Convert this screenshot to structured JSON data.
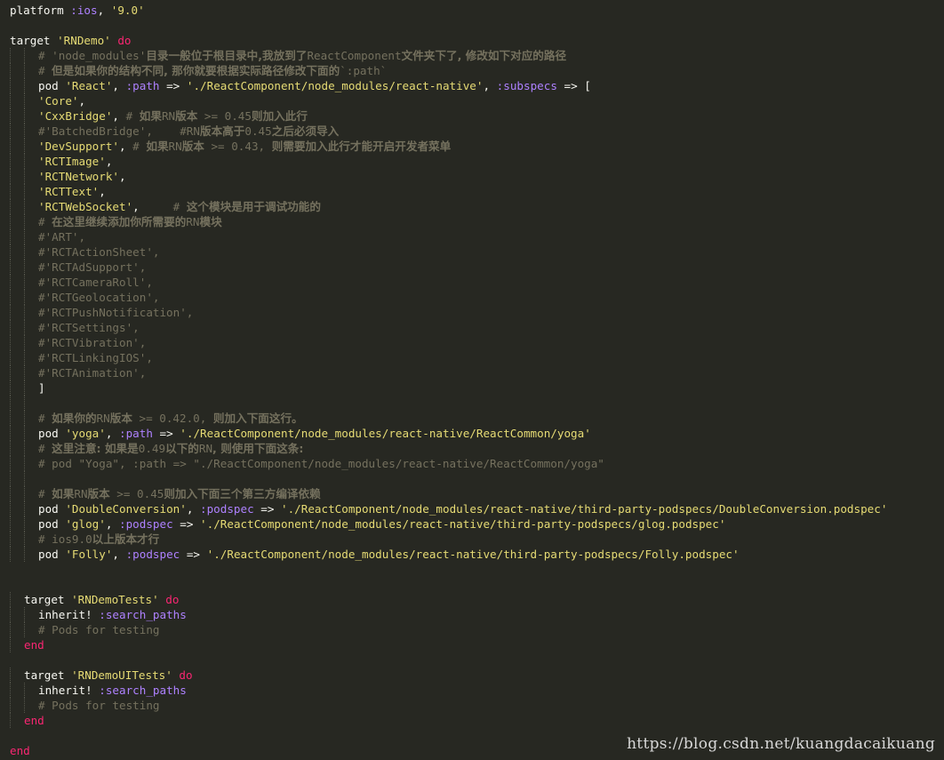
{
  "editor": {
    "theme": {
      "background": "#272822",
      "plain": "#f8f8f2",
      "string": "#e6db74",
      "symbol": "#ae81ff",
      "keyword": "#f92672",
      "comment": "#75715e"
    },
    "lines": [
      {
        "indent": 0,
        "tokens": [
          {
            "t": "platform ",
            "c": "plain"
          },
          {
            "t": ":ios",
            "c": "sym"
          },
          {
            "t": ", ",
            "c": "plain"
          },
          {
            "t": "'9.0'",
            "c": "str"
          }
        ]
      },
      {
        "indent": 0,
        "tokens": []
      },
      {
        "indent": 0,
        "tokens": [
          {
            "t": "target ",
            "c": "plain"
          },
          {
            "t": "'RNDemo'",
            "c": "str"
          },
          {
            "t": " ",
            "c": "plain"
          },
          {
            "t": "do",
            "c": "kw"
          }
        ]
      },
      {
        "indent": 2,
        "tokens": [
          {
            "t": "# 'node_modules'",
            "c": "cmt"
          },
          {
            "t": "目录一般位于根目录中,我放到了",
            "c": "cmt-zh"
          },
          {
            "t": "ReactComponent",
            "c": "cmt"
          },
          {
            "t": "文件夹下了, 修改如下对应的路径",
            "c": "cmt-zh"
          }
        ]
      },
      {
        "indent": 2,
        "tokens": [
          {
            "t": "# ",
            "c": "cmt"
          },
          {
            "t": "但是如果你的结构不同, 那你就要根据实际路径修改下面的",
            "c": "cmt-zh"
          },
          {
            "t": "`:path`",
            "c": "cmt"
          }
        ]
      },
      {
        "indent": 2,
        "tokens": [
          {
            "t": "pod ",
            "c": "plain"
          },
          {
            "t": "'React'",
            "c": "str"
          },
          {
            "t": ", ",
            "c": "plain"
          },
          {
            "t": ":path",
            "c": "sym"
          },
          {
            "t": " => ",
            "c": "plain"
          },
          {
            "t": "'./ReactComponent/node_modules/react-native'",
            "c": "str"
          },
          {
            "t": ", ",
            "c": "plain"
          },
          {
            "t": ":subspecs",
            "c": "sym"
          },
          {
            "t": " => [",
            "c": "plain"
          }
        ]
      },
      {
        "indent": 2,
        "tokens": [
          {
            "t": "'Core'",
            "c": "str"
          },
          {
            "t": ",",
            "c": "plain"
          }
        ]
      },
      {
        "indent": 2,
        "tokens": [
          {
            "t": "'CxxBridge'",
            "c": "str"
          },
          {
            "t": ", ",
            "c": "plain"
          },
          {
            "t": "# ",
            "c": "cmt"
          },
          {
            "t": "如果",
            "c": "cmt-zh"
          },
          {
            "t": "RN",
            "c": "cmt"
          },
          {
            "t": "版本",
            "c": "cmt-zh"
          },
          {
            "t": " >= 0.45",
            "c": "cmt"
          },
          {
            "t": "则加入此行",
            "c": "cmt-zh"
          }
        ]
      },
      {
        "indent": 2,
        "tokens": [
          {
            "t": "#'BatchedBridge',    #RN",
            "c": "cmt"
          },
          {
            "t": "版本高于",
            "c": "cmt-zh"
          },
          {
            "t": "0.45",
            "c": "cmt"
          },
          {
            "t": "之后必须导入",
            "c": "cmt-zh"
          }
        ]
      },
      {
        "indent": 2,
        "tokens": [
          {
            "t": "'DevSupport'",
            "c": "str"
          },
          {
            "t": ", ",
            "c": "plain"
          },
          {
            "t": "# ",
            "c": "cmt"
          },
          {
            "t": "如果",
            "c": "cmt-zh"
          },
          {
            "t": "RN",
            "c": "cmt"
          },
          {
            "t": "版本",
            "c": "cmt-zh"
          },
          {
            "t": " >= 0.43, ",
            "c": "cmt"
          },
          {
            "t": "则需要加入此行才能开启开发者菜单",
            "c": "cmt-zh"
          }
        ]
      },
      {
        "indent": 2,
        "tokens": [
          {
            "t": "'RCTImage'",
            "c": "str"
          },
          {
            "t": ",",
            "c": "plain"
          }
        ]
      },
      {
        "indent": 2,
        "tokens": [
          {
            "t": "'RCTNetwork'",
            "c": "str"
          },
          {
            "t": ",",
            "c": "plain"
          }
        ]
      },
      {
        "indent": 2,
        "tokens": [
          {
            "t": "'RCTText'",
            "c": "str"
          },
          {
            "t": ",",
            "c": "plain"
          }
        ]
      },
      {
        "indent": 2,
        "tokens": [
          {
            "t": "'RCTWebSocket'",
            "c": "str"
          },
          {
            "t": ",     ",
            "c": "plain"
          },
          {
            "t": "# ",
            "c": "cmt"
          },
          {
            "t": "这个模块是用于调试功能的",
            "c": "cmt-zh"
          }
        ]
      },
      {
        "indent": 2,
        "tokens": [
          {
            "t": "# ",
            "c": "cmt"
          },
          {
            "t": "在这里继续添加你所需要的",
            "c": "cmt-zh"
          },
          {
            "t": "RN",
            "c": "cmt"
          },
          {
            "t": "模块",
            "c": "cmt-zh"
          }
        ]
      },
      {
        "indent": 2,
        "tokens": [
          {
            "t": "#'ART',",
            "c": "cmt"
          }
        ]
      },
      {
        "indent": 2,
        "tokens": [
          {
            "t": "#'RCTActionSheet',",
            "c": "cmt"
          }
        ]
      },
      {
        "indent": 2,
        "tokens": [
          {
            "t": "#'RCTAdSupport',",
            "c": "cmt"
          }
        ]
      },
      {
        "indent": 2,
        "tokens": [
          {
            "t": "#'RCTCameraRoll',",
            "c": "cmt"
          }
        ]
      },
      {
        "indent": 2,
        "tokens": [
          {
            "t": "#'RCTGeolocation',",
            "c": "cmt"
          }
        ]
      },
      {
        "indent": 2,
        "tokens": [
          {
            "t": "#'RCTPushNotification',",
            "c": "cmt"
          }
        ]
      },
      {
        "indent": 2,
        "tokens": [
          {
            "t": "#'RCTSettings',",
            "c": "cmt"
          }
        ]
      },
      {
        "indent": 2,
        "tokens": [
          {
            "t": "#'RCTVibration',",
            "c": "cmt"
          }
        ]
      },
      {
        "indent": 2,
        "tokens": [
          {
            "t": "#'RCTLinkingIOS',",
            "c": "cmt"
          }
        ]
      },
      {
        "indent": 2,
        "tokens": [
          {
            "t": "#'RCTAnimation',",
            "c": "cmt"
          }
        ]
      },
      {
        "indent": 2,
        "tokens": [
          {
            "t": "]",
            "c": "plain"
          }
        ]
      },
      {
        "indent": 2,
        "tokens": []
      },
      {
        "indent": 2,
        "tokens": [
          {
            "t": "# ",
            "c": "cmt"
          },
          {
            "t": "如果你的",
            "c": "cmt-zh"
          },
          {
            "t": "RN",
            "c": "cmt"
          },
          {
            "t": "版本",
            "c": "cmt-zh"
          },
          {
            "t": " >= 0.42.0, ",
            "c": "cmt"
          },
          {
            "t": "则加入下面这行。",
            "c": "cmt-zh"
          }
        ]
      },
      {
        "indent": 2,
        "tokens": [
          {
            "t": "pod ",
            "c": "plain"
          },
          {
            "t": "'yoga'",
            "c": "str"
          },
          {
            "t": ", ",
            "c": "plain"
          },
          {
            "t": ":path",
            "c": "sym"
          },
          {
            "t": " => ",
            "c": "plain"
          },
          {
            "t": "'./ReactComponent/node_modules/react-native/ReactCommon/yoga'",
            "c": "str"
          }
        ]
      },
      {
        "indent": 2,
        "tokens": [
          {
            "t": "# ",
            "c": "cmt"
          },
          {
            "t": "这里注意: 如果是",
            "c": "cmt-zh"
          },
          {
            "t": "0.49",
            "c": "cmt"
          },
          {
            "t": "以下的",
            "c": "cmt-zh"
          },
          {
            "t": "RN",
            "c": "cmt"
          },
          {
            "t": ", 则使用下面这条:",
            "c": "cmt-zh"
          }
        ]
      },
      {
        "indent": 2,
        "tokens": [
          {
            "t": "# pod \"Yoga\", :path => \"./ReactComponent/node_modules/react-native/ReactCommon/yoga\"",
            "c": "cmt"
          }
        ]
      },
      {
        "indent": 2,
        "tokens": []
      },
      {
        "indent": 2,
        "tokens": [
          {
            "t": "# ",
            "c": "cmt"
          },
          {
            "t": "如果",
            "c": "cmt-zh"
          },
          {
            "t": "RN",
            "c": "cmt"
          },
          {
            "t": "版本",
            "c": "cmt-zh"
          },
          {
            "t": " >= 0.45",
            "c": "cmt"
          },
          {
            "t": "则加入下面三个第三方编译依赖",
            "c": "cmt-zh"
          }
        ]
      },
      {
        "indent": 2,
        "tokens": [
          {
            "t": "pod ",
            "c": "plain"
          },
          {
            "t": "'DoubleConversion'",
            "c": "str"
          },
          {
            "t": ", ",
            "c": "plain"
          },
          {
            "t": ":podspec",
            "c": "sym"
          },
          {
            "t": " => ",
            "c": "plain"
          },
          {
            "t": "'./ReactComponent/node_modules/react-native/third-party-podspecs/DoubleConversion.podspec'",
            "c": "str"
          }
        ]
      },
      {
        "indent": 2,
        "tokens": [
          {
            "t": "pod ",
            "c": "plain"
          },
          {
            "t": "'glog'",
            "c": "str"
          },
          {
            "t": ", ",
            "c": "plain"
          },
          {
            "t": ":podspec",
            "c": "sym"
          },
          {
            "t": " => ",
            "c": "plain"
          },
          {
            "t": "'./ReactComponent/node_modules/react-native/third-party-podspecs/glog.podspec'",
            "c": "str"
          }
        ]
      },
      {
        "indent": 2,
        "tokens": [
          {
            "t": "# ios9.0",
            "c": "cmt"
          },
          {
            "t": "以上版本才行",
            "c": "cmt-zh"
          }
        ]
      },
      {
        "indent": 2,
        "tokens": [
          {
            "t": "pod ",
            "c": "plain"
          },
          {
            "t": "'Folly'",
            "c": "str"
          },
          {
            "t": ", ",
            "c": "plain"
          },
          {
            "t": ":podspec",
            "c": "sym"
          },
          {
            "t": " => ",
            "c": "plain"
          },
          {
            "t": "'./ReactComponent/node_modules/react-native/third-party-podspecs/Folly.podspec'",
            "c": "str"
          }
        ]
      },
      {
        "indent": 0,
        "tokens": []
      },
      {
        "indent": 0,
        "tokens": []
      },
      {
        "indent": 1,
        "tokens": [
          {
            "t": "target ",
            "c": "plain"
          },
          {
            "t": "'RNDemoTests'",
            "c": "str"
          },
          {
            "t": " ",
            "c": "plain"
          },
          {
            "t": "do",
            "c": "kw"
          }
        ]
      },
      {
        "indent": 2,
        "tokens": [
          {
            "t": "inherit! ",
            "c": "plain"
          },
          {
            "t": ":search_paths",
            "c": "sym"
          }
        ]
      },
      {
        "indent": 2,
        "tokens": [
          {
            "t": "# Pods for testing",
            "c": "cmt"
          }
        ]
      },
      {
        "indent": 1,
        "tokens": [
          {
            "t": "end",
            "c": "kw"
          }
        ]
      },
      {
        "indent": 0,
        "tokens": []
      },
      {
        "indent": 1,
        "tokens": [
          {
            "t": "target ",
            "c": "plain"
          },
          {
            "t": "'RNDemoUITests'",
            "c": "str"
          },
          {
            "t": " ",
            "c": "plain"
          },
          {
            "t": "do",
            "c": "kw"
          }
        ]
      },
      {
        "indent": 2,
        "tokens": [
          {
            "t": "inherit! ",
            "c": "plain"
          },
          {
            "t": ":search_paths",
            "c": "sym"
          }
        ]
      },
      {
        "indent": 2,
        "tokens": [
          {
            "t": "# Pods for testing",
            "c": "cmt"
          }
        ]
      },
      {
        "indent": 1,
        "tokens": [
          {
            "t": "end",
            "c": "kw"
          }
        ]
      },
      {
        "indent": 0,
        "tokens": []
      },
      {
        "indent": 0,
        "tokens": [
          {
            "t": "end",
            "c": "kw"
          }
        ]
      }
    ]
  },
  "watermark": "https://blog.csdn.net/kuangdacaikuang"
}
